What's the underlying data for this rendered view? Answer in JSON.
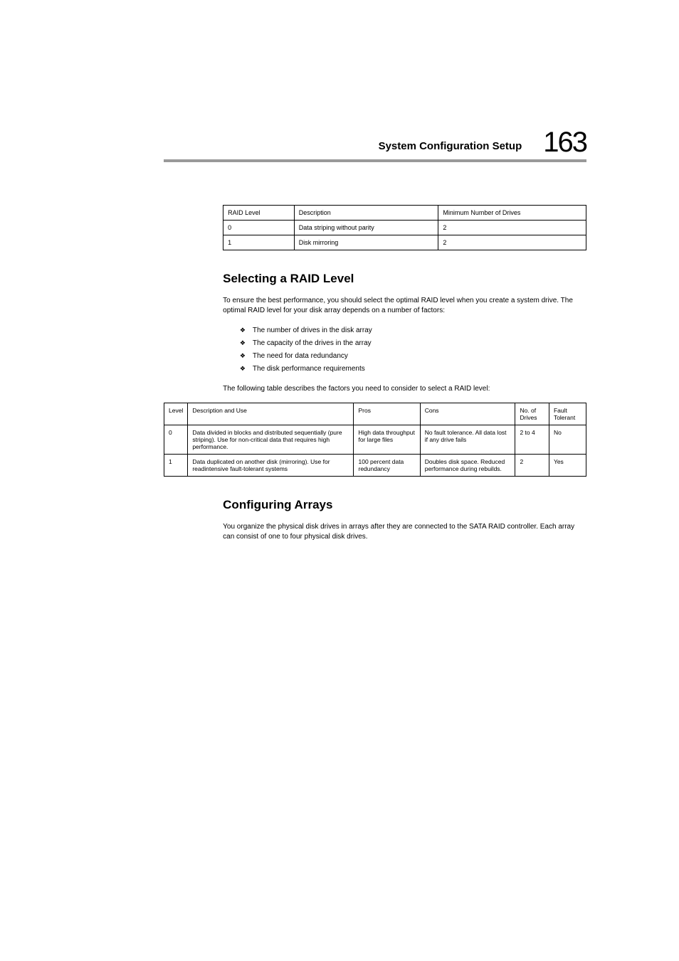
{
  "header": {
    "title": "System Configuration Setup",
    "page_number": "163"
  },
  "table1": {
    "headers": [
      "RAID Level",
      "Description",
      "Minimum Number of Drives"
    ],
    "rows": [
      [
        "0",
        "Data striping without parity",
        "2"
      ],
      [
        "1",
        "Disk mirroring",
        "2"
      ]
    ]
  },
  "section1": {
    "heading": "Selecting a RAID Level",
    "para1": "To ensure the best performance, you should select the optimal RAID level when you create a system drive. The optimal RAID level for your disk array depends on a number of factors:",
    "bullets": [
      "The number of drives in the disk array",
      "The capacity of the drives in the array",
      "The need for data redundancy",
      "The disk performance requirements"
    ],
    "para2": "The following table describes the factors you need to consider to select a RAID level:"
  },
  "table2": {
    "headers": [
      "Level",
      "Description and Use",
      "Pros",
      "Cons",
      "No. of Drives",
      "Fault Tolerant"
    ],
    "rows": [
      [
        "0",
        "Data divided in blocks and distributed sequentially (pure striping). Use for non-critical data that requires high performance.",
        "High data throughput for large files",
        "No fault tolerance. All data lost if any drive fails",
        "2 to 4",
        "No"
      ],
      [
        "1",
        "Data duplicated on another disk (mirroring). Use for readintensive fault-tolerant systems",
        "100 percent data redundancy",
        "Doubles disk space. Reduced performance during rebuilds.",
        "2",
        "Yes"
      ]
    ]
  },
  "section2": {
    "heading": "Configuring Arrays",
    "para": "You organize the physical disk drives in arrays after they are connected to the SATA RAID controller. Each array can consist of one to four physical disk drives."
  }
}
